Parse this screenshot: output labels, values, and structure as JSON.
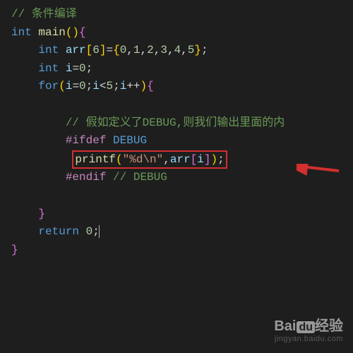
{
  "code": {
    "comment1": "// 条件编译",
    "kw_int": "int",
    "fn_main": "main",
    "arr_name": "arr",
    "arr_size": "6",
    "arr_vals": [
      "0",
      "1",
      "2",
      "3",
      "4",
      "5"
    ],
    "var_i": "i",
    "init_val": "0",
    "kw_for": "for",
    "cond_limit": "5",
    "comment2": "// 假如定义了DEBUG,则我们输出里面的内",
    "ifdef": "#ifdef",
    "debug": "DEBUG",
    "printf": "printf",
    "fmt": "\"%d\\n\"",
    "endif": "#endif",
    "endif_comment": "// DEBUG",
    "kw_return": "return",
    "ret_val": "0"
  },
  "watermark": {
    "brand1": "Bai",
    "brand2": "du",
    "brand3": "经验",
    "url": "jingyan.baidu.com"
  }
}
